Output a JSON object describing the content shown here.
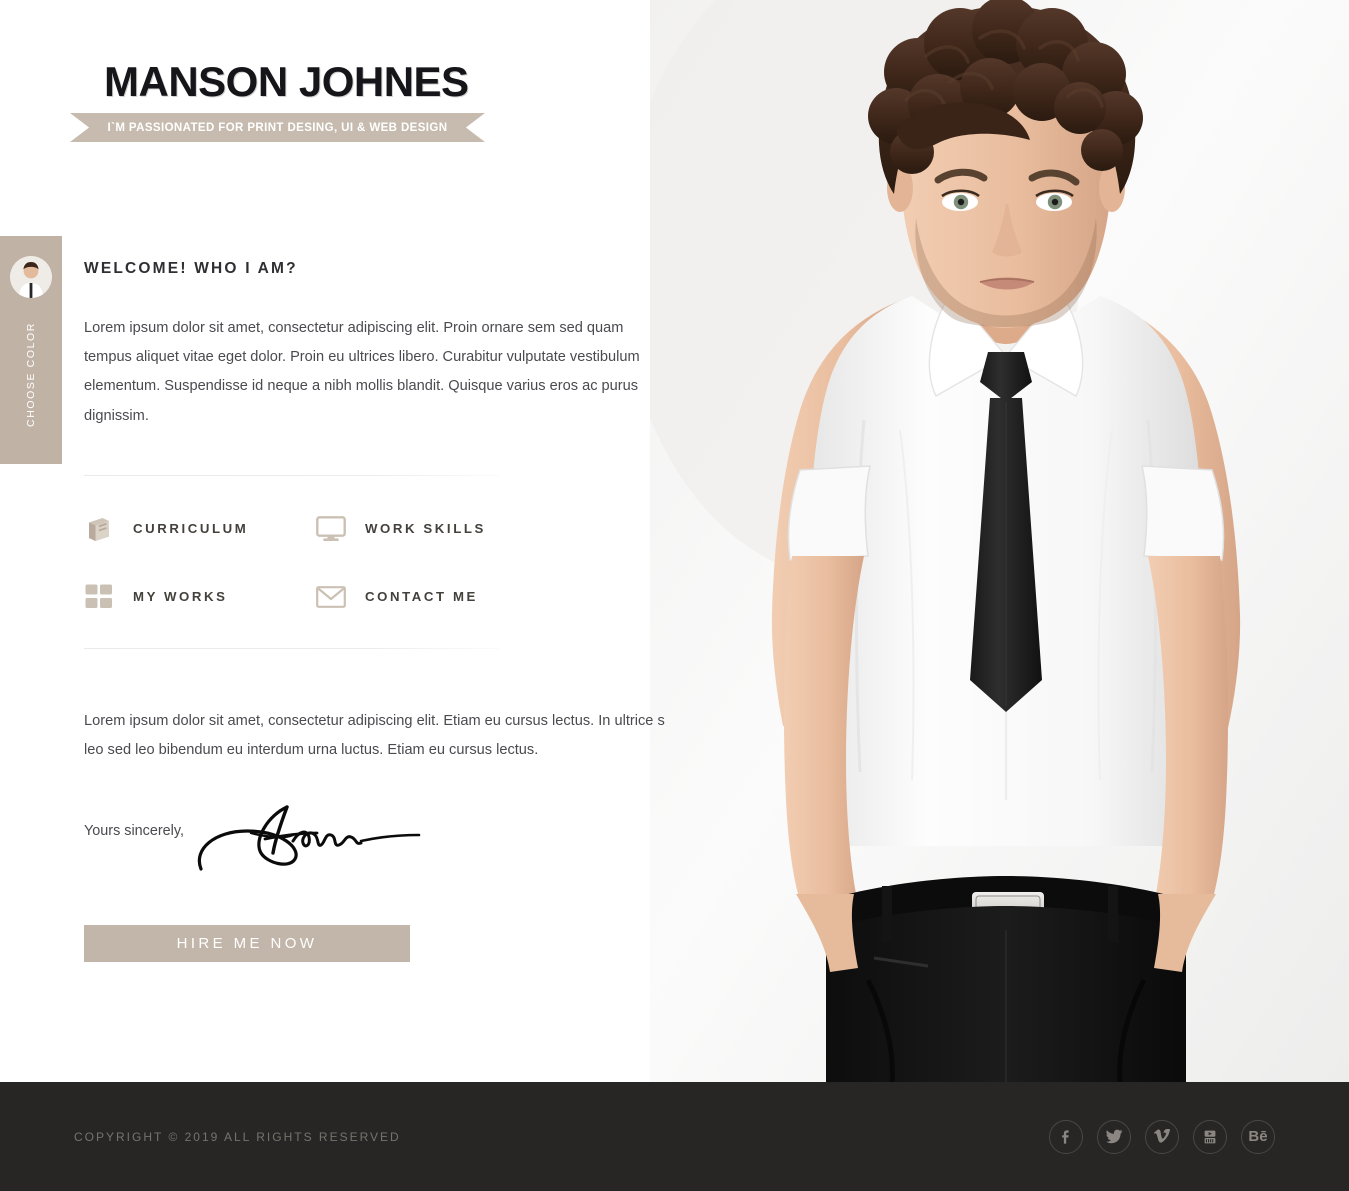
{
  "site": {
    "title": "MANSON JOHNES",
    "tagline": "I`M PASSIONATED FOR PRINT DESING, UI & WEB DESIGN"
  },
  "color_picker": {
    "label": "CHOOSE COLOR",
    "avatar_icon": "person-avatar-icon",
    "tab_color": "#c0b3a6"
  },
  "about": {
    "heading": "WELCOME! WHO I AM?",
    "paragraph": "Lorem ipsum dolor sit amet, consectetur adipiscing elit. Proin ornare sem sed quam tempus aliquet vitae eget dolor. Proin eu ultrices libero. Curabitur vulputate vestibulum elementum. Suspendisse id neque a nibh mollis blandit. Quisque varius eros ac purus dignissim."
  },
  "nav": {
    "items": [
      {
        "label": "CURRICULUM",
        "icon": "book-icon"
      },
      {
        "label": "WORK SKILLS",
        "icon": "monitor-icon"
      },
      {
        "label": "MY WORKS",
        "icon": "grid-squares-icon"
      },
      {
        "label": "CONTACT ME",
        "icon": "envelope-icon"
      }
    ]
  },
  "outro": {
    "paragraph": "Lorem ipsum dolor sit amet, consectetur adipiscing elit. Etiam eu cursus lectus. In ultrice s leo sed leo bibendum eu interdum urna luctus. Etiam eu cursus lectus.",
    "signoff": "Yours sincerely,",
    "signature_icon": "handwritten-signature"
  },
  "cta": {
    "label": "HIRE ME NOW",
    "color": "#c2b5a9"
  },
  "hero": {
    "image_alt": "portrait-man-white-shirt-black-tie"
  },
  "footer": {
    "copyright": "COPYRIGHT © 2019 ALL RIGHTS RESERVED",
    "background": "#272625",
    "socials": [
      {
        "name": "facebook",
        "icon": "facebook-icon",
        "glyph": "f"
      },
      {
        "name": "twitter",
        "icon": "twitter-icon",
        "glyph": ""
      },
      {
        "name": "vimeo",
        "icon": "vimeo-icon",
        "glyph": "v"
      },
      {
        "name": "youtube",
        "icon": "youtube-icon",
        "glyph": ""
      },
      {
        "name": "behance",
        "icon": "behance-icon",
        "glyph": "Bē"
      }
    ]
  }
}
